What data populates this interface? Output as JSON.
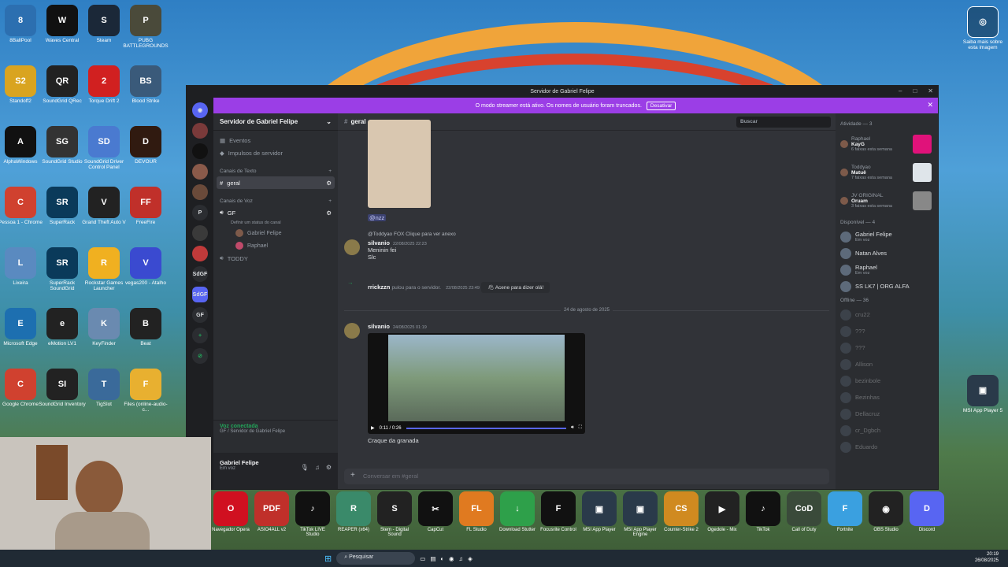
{
  "desktop": {
    "icons": [
      {
        "label": "8BallPool",
        "color": "#2c6fb0",
        "glyph": "8"
      },
      {
        "label": "Waves Central",
        "color": "#111",
        "glyph": "W"
      },
      {
        "label": "Steam",
        "color": "#1b2838",
        "glyph": "S"
      },
      {
        "label": "PUBG BATTLEGROUNDS",
        "color": "#4a4a3a",
        "glyph": "P"
      },
      {
        "label": "Standoff2",
        "color": "#d9a420",
        "glyph": "S2"
      },
      {
        "label": "SoundGrid QRec",
        "color": "#222",
        "glyph": "QR"
      },
      {
        "label": "Torque Drift 2",
        "color": "#d12020",
        "glyph": "2"
      },
      {
        "label": "Blood Strike",
        "color": "#3a5a7a",
        "glyph": "BS"
      },
      {
        "label": "AlphaWindows",
        "color": "#111",
        "glyph": "A"
      },
      {
        "label": "SoundGrid Studio",
        "color": "#333",
        "glyph": "SG"
      },
      {
        "label": "SoundGrid Driver Control Panel",
        "color": "#4a7ad0",
        "glyph": "SD"
      },
      {
        "label": "DEVOUR",
        "color": "#301a10",
        "glyph": "D"
      },
      {
        "label": "Pessoa 1 - Chrome",
        "color": "#d0412f",
        "glyph": "C"
      },
      {
        "label": "SuperRack",
        "color": "#0a3a5a",
        "glyph": "SR"
      },
      {
        "label": "Grand Theft Auto V",
        "color": "#222",
        "glyph": "V"
      },
      {
        "label": "FreeFire",
        "color": "#c0302a",
        "glyph": "FF"
      },
      {
        "label": "Lixeira",
        "color": "#5a8ac0",
        "glyph": "L"
      },
      {
        "label": "SuperRack SoundGrid",
        "color": "#0a3a5a",
        "glyph": "SR"
      },
      {
        "label": "Rockstar Games Launcher",
        "color": "#f0b020",
        "glyph": "R"
      },
      {
        "label": "vegas200 - Atalho",
        "color": "#3a4ad0",
        "glyph": "V"
      },
      {
        "label": "Microsoft Edge",
        "color": "#1d6fb0",
        "glyph": "E"
      },
      {
        "label": "eMotion LV1",
        "color": "#222",
        "glyph": "e"
      },
      {
        "label": "KeyFinder",
        "color": "#6a8ab0",
        "glyph": "K"
      },
      {
        "label": "Beat",
        "color": "#222",
        "glyph": "B"
      },
      {
        "label": "Google Chrome",
        "color": "#d0412f",
        "glyph": "C"
      },
      {
        "label": "SoundGrid Inventory",
        "color": "#222",
        "glyph": "SI"
      },
      {
        "label": "TigSlot",
        "color": "#3a6a9a",
        "glyph": "T"
      },
      {
        "label": "Files (online-audio-c...",
        "color": "#e8b030",
        "glyph": "F"
      }
    ],
    "right_icons": [
      {
        "label": "Saiba mais sobre esta imagem",
        "glyph": "◎"
      },
      {
        "label": "MSI App Player 5",
        "glyph": "▣"
      }
    ]
  },
  "discord": {
    "window_title": "Servidor de Gabriel Felipe",
    "banner_text": "O modo streamer está ativo. Os nomes de usuário foram truncados.",
    "banner_button": "Desativar",
    "rail": [
      "SdGF",
      "GF"
    ],
    "server_name": "Servidor de Gabriel Felipe",
    "events": "Eventos",
    "boosts": "Impulsos de servidor",
    "text_category": "Canais de Texto",
    "text_channel": "geral",
    "voice_category": "Canais de Voz",
    "voice_channel": "GF",
    "voice_status": "Definir um status do canal",
    "voice_users": [
      "Gabriel Felipe",
      "Raphael"
    ],
    "other_channel": "TODDY",
    "voice_connected": "Voz conectada",
    "voice_connected_sub": "GF / Servidor de Gabriel Felipe",
    "user_name": "Gabriel Felipe",
    "user_status": "Em voz",
    "channel_header": "geral",
    "search_placeholder": "Buscar",
    "mention": "@nzz",
    "reply_line": "@Toddyao  FOX  Clique para ver anexo",
    "msg1": {
      "user": "silvanio",
      "time": "22/08/2025 22:23",
      "lines": [
        "Meninin fei",
        "Slc"
      ]
    },
    "join": {
      "user": "rrickzzn",
      "text": "pulou para o servidor.",
      "time": "22/08/2025 23:49",
      "wave": "Acene para dizer olá!"
    },
    "date_divider": "24 de agosto de 2025",
    "msg2": {
      "user": "silvanio",
      "time": "24/08/2025 01:19",
      "video_time": "0:11 / 0:26",
      "caption": "Craque da granada"
    },
    "composer_placeholder": "Conversar em #geral",
    "activity_title": "Atividade — 3",
    "activity": [
      {
        "name": "Raphael",
        "game": "KayG",
        "sub": "6 faixas esta semana"
      },
      {
        "name": "Toddyao",
        "game": "Matuê",
        "sub": "7 faixas esta semana"
      },
      {
        "name": "JV ORIGINAL",
        "game": "Oruam",
        "sub": "3 faixas esta semana"
      }
    ],
    "online_title": "Disponível — 4",
    "online": [
      {
        "name": "Gabriel Felipe",
        "sub": "Em voz"
      },
      {
        "name": "Natan Alves",
        "sub": ""
      },
      {
        "name": "Raphael",
        "sub": "Em voz"
      },
      {
        "name": "SS LK7 | ORG ALFA",
        "sub": ""
      }
    ],
    "offline_title": "Offline — 36",
    "offline": [
      "cru22",
      "???",
      "???",
      "Allison",
      "bezinbole",
      "Bezinhas",
      "Dellacruz",
      "cr_Dgbch",
      "Eduardo"
    ]
  },
  "dock": [
    {
      "label": "Navegador Opera",
      "color": "#d01020",
      "glyph": "O"
    },
    {
      "label": "ASIO4ALL v2",
      "color": "#c0302a",
      "glyph": "PDF"
    },
    {
      "label": "TikTok LIVE Studio",
      "color": "#111",
      "glyph": "♪"
    },
    {
      "label": "REAPER (x64)",
      "color": "#3a8a6a",
      "glyph": "R"
    },
    {
      "label": "Stem - Digital Sound",
      "color": "#222",
      "glyph": "S"
    },
    {
      "label": "CapCut",
      "color": "#111",
      "glyph": "✂"
    },
    {
      "label": "FL Studio",
      "color": "#e07a20",
      "glyph": "FL"
    },
    {
      "label": "Download Stutter",
      "color": "#2ea04a",
      "glyph": "↓"
    },
    {
      "label": "Focusrite Control",
      "color": "#111",
      "glyph": "F"
    },
    {
      "label": "MSI App Player",
      "color": "#2a3a4a",
      "glyph": "▣"
    },
    {
      "label": "MSI App Player Engine",
      "color": "#2a3a4a",
      "glyph": "▣"
    },
    {
      "label": "Counter-Strike 2",
      "color": "#d08a20",
      "glyph": "CS"
    },
    {
      "label": "Ogedole - Mix",
      "color": "#222",
      "glyph": "▶"
    },
    {
      "label": "TikTok",
      "color": "#111",
      "glyph": "♪"
    },
    {
      "label": "Call of Duty",
      "color": "#3a4a3a",
      "glyph": "CoD"
    },
    {
      "label": "Fortnite",
      "color": "#3aa0e0",
      "glyph": "F"
    },
    {
      "label": "OBS Studio",
      "color": "#222",
      "glyph": "◉"
    },
    {
      "label": "Discord",
      "color": "#5865f2",
      "glyph": "D"
    }
  ],
  "taskbar": {
    "search": "Pesquisar",
    "time": "20:19",
    "date": "26/08/2025"
  }
}
